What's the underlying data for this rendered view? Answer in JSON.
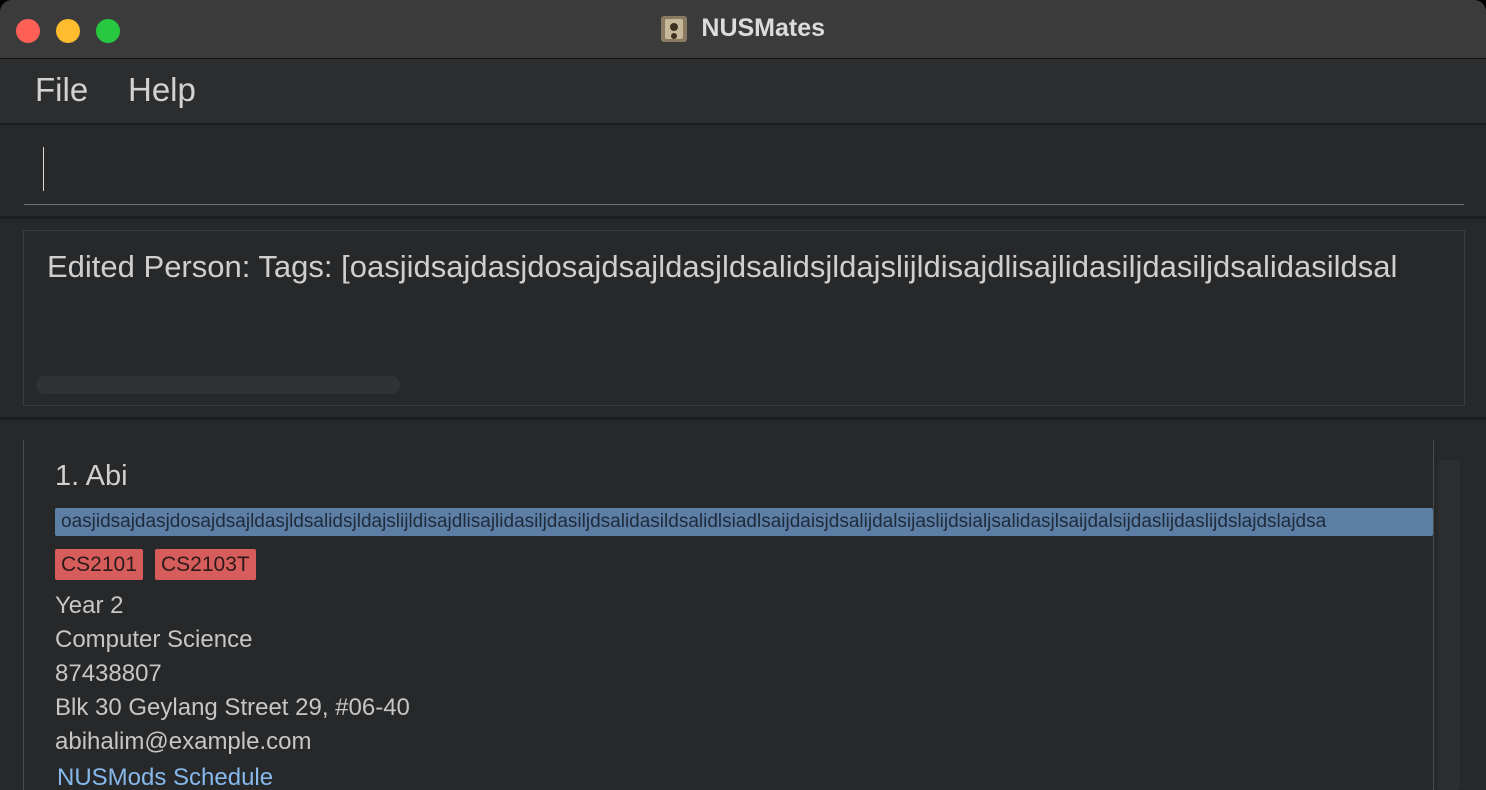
{
  "window": {
    "title": "NUSMates"
  },
  "menu": {
    "items": [
      {
        "label": "File"
      },
      {
        "label": "Help"
      }
    ]
  },
  "command": {
    "value": ""
  },
  "result": {
    "text": "Edited Person: Tags: [oasjidsajdasjdosajdsajldasjldsalidsjldajslijldisajdlisajlidasiljdasiljdsalidasildsal"
  },
  "persons": [
    {
      "index_name": "1. Abi",
      "highlight_tag": "oasjidsajdasjdosajdsajldasjldsalidsjldajslijldisajdlisajlidasiljdasiljdsalidasildsalidlsiadlsaijdaisjdsalijdalsijaslijdsialjsalidasjlsaijdalsijdaslijdaslijdslajdslajdsa",
      "module_tags": [
        "CS2101",
        "CS2103T"
      ],
      "year": "Year 2",
      "major": "Computer Science",
      "phone": "87438807",
      "address": "Blk 30 Geylang Street 29, #06-40",
      "email": "abihalim@example.com",
      "schedule_link": "NUSMods Schedule"
    }
  ],
  "colors": {
    "background": "#262829",
    "highlight_tag": "#5d7fa6",
    "module_tag": "#d65d5b",
    "link": "#86b8ec"
  }
}
